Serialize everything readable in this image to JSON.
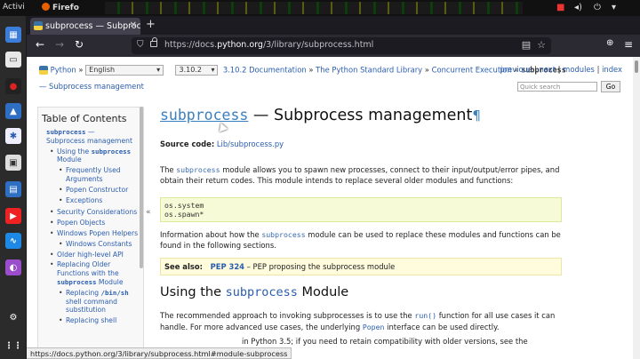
{
  "system": {
    "activities": "Activi",
    "app_name": "Firefo",
    "tray_icons": [
      "record-icon",
      "volume-icon",
      "power-icon",
      "menu-icon"
    ]
  },
  "dock": [
    "calendar-icon",
    "terminal-icon",
    "record-icon",
    "flame-icon",
    "bug-icon",
    "package-icon",
    "pdf-icon",
    "youtube-icon",
    "chart-icon",
    "media-icon",
    "settings-icon",
    "apps-grid-icon"
  ],
  "browser": {
    "tab_title": "subprocess — Subproce",
    "url_prefix": "https://docs.",
    "url_host": "python.org",
    "url_path": "/3/library/subprocess.html",
    "status_link": "https://docs.python.org/3/library/subprocess.html#module-subprocess"
  },
  "related": {
    "python_link": "Python",
    "language": "English",
    "version": "3.10.2",
    "breadcrumbs": [
      "3.10.2 Documentation",
      "The Python Standard Library",
      "Concurrent Execution"
    ],
    "current": "subprocess",
    "sep": "»",
    "right_links": [
      "previous",
      "next",
      "modules",
      "index"
    ],
    "crumb_line2": "— Subprocess management",
    "search_placeholder": "Quick search",
    "go": "Go"
  },
  "sidebar": {
    "heading": "Table of Contents",
    "module": "subprocess",
    "module_suffix": "—",
    "module_desc": "Subprocess management",
    "using_pre": "Using the",
    "using_code": "subprocess",
    "using_post": "Module",
    "items": {
      "frequently": "Frequently Used Arguments",
      "popen_ctor": "Popen Constructor",
      "exceptions": "Exceptions",
      "security": "Security Considerations",
      "popen_obj": "Popen Objects",
      "win_helpers": "Windows Popen Helpers",
      "win_const": "Windows Constants",
      "older_api": "Older high-level API",
      "replacing_pre": "Replacing Older Functions with the",
      "replacing_code": "subprocess",
      "replacing_post": "Module",
      "rep_binsh_pre": "Replacing",
      "rep_binsh_code": "/bin/sh",
      "rep_binsh_post": "shell command substitution",
      "rep_shell": "Replacing shell"
    },
    "collapse": "«"
  },
  "main": {
    "title_code": "subprocess",
    "title_rest": "— Subprocess management",
    "pilcrow": "¶",
    "source_label": "Source code:",
    "source_link": "Lib/subprocess.py",
    "intro": {
      "pre": "The",
      "code": "subprocess",
      "post": "module allows you to spawn new processes, connect to their input/output/error pipes, and obtain their return codes. This module intends to replace several older modules and functions:"
    },
    "code_lines": [
      "os.system",
      "os.spawn*"
    ],
    "info": {
      "pre": "Information about how the",
      "code": "subprocess",
      "post": "module can be used to replace these modules and functions can be found in the following sections."
    },
    "see_also_label": "See also:",
    "see_also_link": "PEP 324",
    "see_also_text": "– PEP proposing the subprocess module",
    "h2_pre": "Using the",
    "h2_code": "subprocess",
    "h2_post": "Module",
    "rec": {
      "pre": "The recommended approach to invoking subprocesses is to use the",
      "code1": "run()",
      "mid": "function for all use cases it can handle. For more advanced use cases, the underlying",
      "code2": "Popen",
      "post": "interface can be used directly."
    },
    "last_line": "in Python 3.5; if you need to retain compatibility with older versions, see the"
  }
}
